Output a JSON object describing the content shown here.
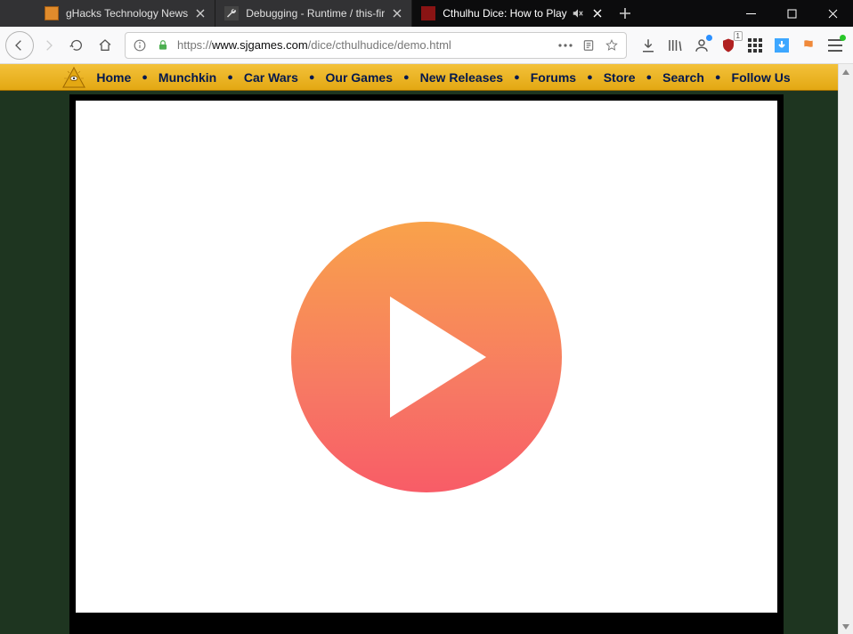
{
  "tabs": [
    {
      "title": "gHacks Technology News",
      "active": false,
      "icon": "orange",
      "mute": false
    },
    {
      "title": "Debugging - Runtime / this-fir",
      "active": false,
      "icon": "wrench",
      "mute": false
    },
    {
      "title": "Cthulhu Dice: How to Play",
      "active": true,
      "icon": "red",
      "mute": true
    }
  ],
  "url": {
    "scheme": "https://",
    "host": "www.sjgames.com",
    "path": "/dice/cthulhudice/demo.html"
  },
  "site_nav": [
    "Home",
    "Munchkin",
    "Car Wars",
    "Our Games",
    "New Releases",
    "Forums",
    "Store",
    "Search",
    "Follow Us"
  ],
  "ublock_count": "1"
}
